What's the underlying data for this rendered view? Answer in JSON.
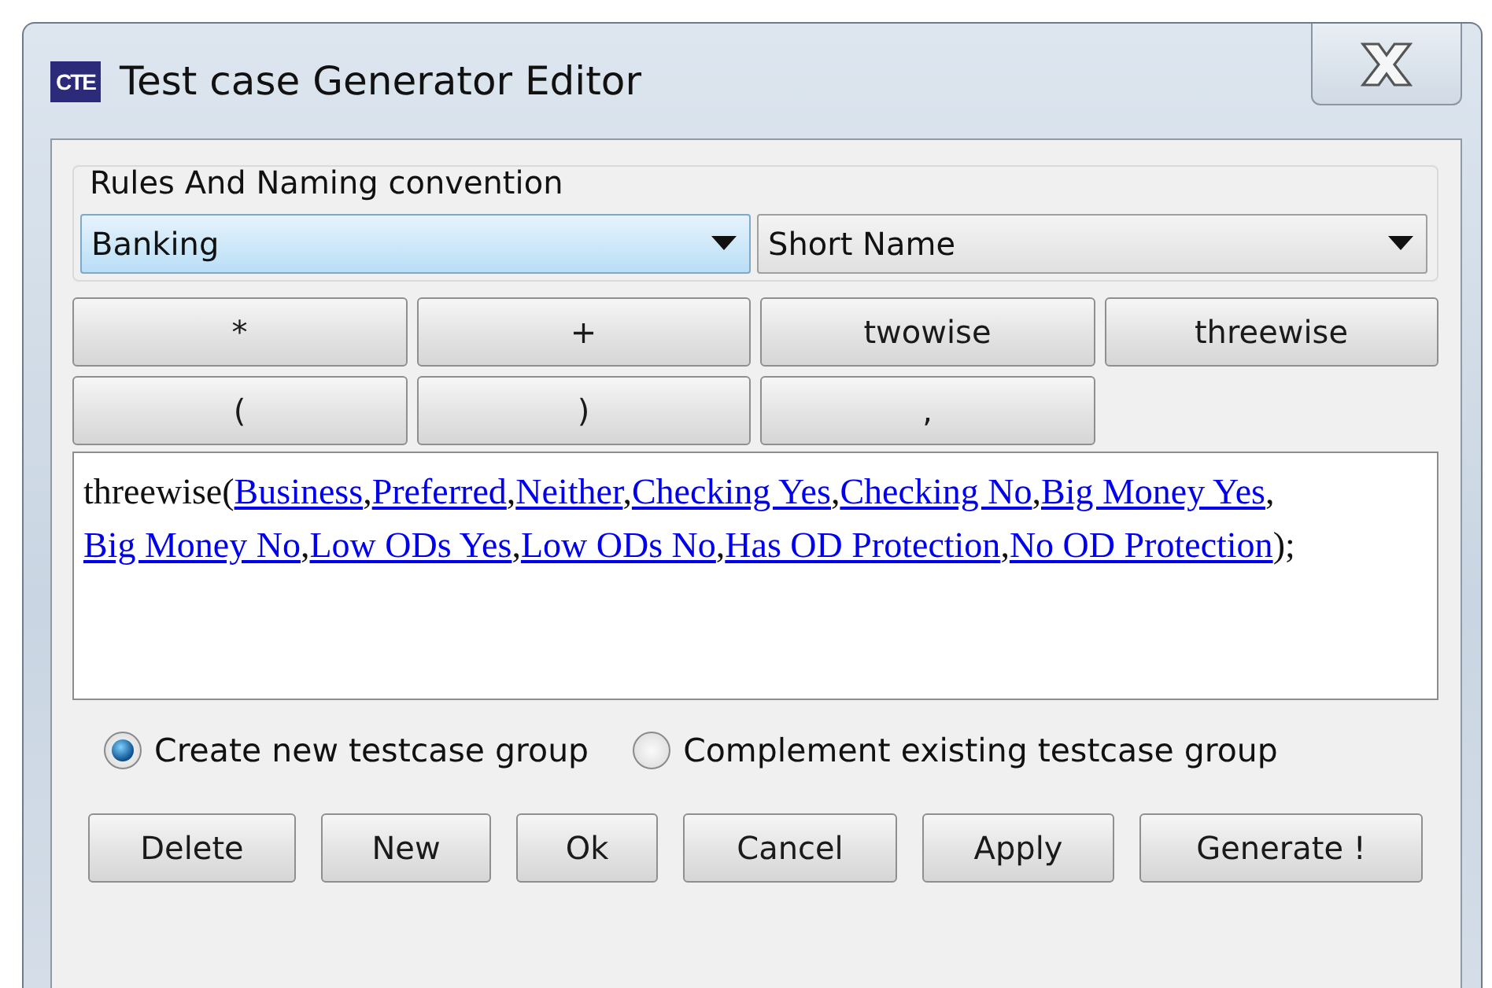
{
  "window": {
    "title": "Test case Generator Editor",
    "icon_text": "CTE"
  },
  "rules_group": {
    "title": "Rules And Naming convention",
    "combos": [
      {
        "value": "Banking",
        "focused": true
      },
      {
        "value": "Short Name",
        "focused": false
      }
    ]
  },
  "operator_buttons": [
    "*",
    "+",
    "twowise",
    "threewise",
    "(",
    ")",
    ","
  ],
  "rule": [
    {
      "kind": "text",
      "text": "threewise("
    },
    {
      "kind": "link",
      "text": "Business"
    },
    {
      "kind": "text",
      "text": ","
    },
    {
      "kind": "link",
      "text": "Preferred"
    },
    {
      "kind": "text",
      "text": ","
    },
    {
      "kind": "link",
      "text": "Neither"
    },
    {
      "kind": "text",
      "text": ","
    },
    {
      "kind": "link",
      "text": "Checking Yes"
    },
    {
      "kind": "text",
      "text": ","
    },
    {
      "kind": "link",
      "text": "Checking No"
    },
    {
      "kind": "text",
      "text": ","
    },
    {
      "kind": "link",
      "text": "Big Money Yes"
    },
    {
      "kind": "text",
      "text": ","
    },
    {
      "kind": "link",
      "text": "Big Money No"
    },
    {
      "kind": "text",
      "text": ","
    },
    {
      "kind": "link",
      "text": "Low ODs Yes"
    },
    {
      "kind": "text",
      "text": ","
    },
    {
      "kind": "link",
      "text": "Low ODs No"
    },
    {
      "kind": "text",
      "text": ","
    },
    {
      "kind": "link",
      "text": "Has OD Protection"
    },
    {
      "kind": "text",
      "text": ","
    },
    {
      "kind": "link",
      "text": "No OD Protection"
    },
    {
      "kind": "text",
      "text": ");"
    }
  ],
  "mode_options": [
    {
      "label": "Create new testcase group",
      "selected": true
    },
    {
      "label": "Complement existing testcase group",
      "selected": false
    }
  ],
  "action_buttons": [
    "Delete",
    "New",
    "Ok",
    "Cancel",
    "Apply",
    "Generate !"
  ]
}
